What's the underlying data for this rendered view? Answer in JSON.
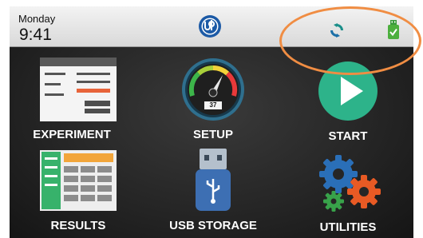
{
  "status_bar": {
    "day": "Monday",
    "time": "9:41",
    "logo_icon": "ub-logo-icon",
    "sync_icon": "sync-icon",
    "usb_status_icon": "usb-connected-icon"
  },
  "menu": {
    "experiment": {
      "label": "EXPERIMENT",
      "icon": "document-form-icon"
    },
    "setup": {
      "label": "SETUP",
      "icon": "gauge-icon",
      "gauge_readout": "37"
    },
    "start": {
      "label": "START",
      "icon": "play-icon"
    },
    "results": {
      "label": "RESULTS",
      "icon": "table-icon"
    },
    "usb_storage": {
      "label": "USB STORAGE",
      "icon": "usb-drive-icon"
    },
    "utilities": {
      "label": "UTILITIES",
      "icon": "gears-icon"
    }
  },
  "colors": {
    "highlight": "#f08d43",
    "start_green": "#2db38a",
    "usb_blue": "#3d6fb3",
    "gear_blue": "#2a6fb8",
    "gear_orange": "#e85a24",
    "gear_green": "#38a24a"
  }
}
